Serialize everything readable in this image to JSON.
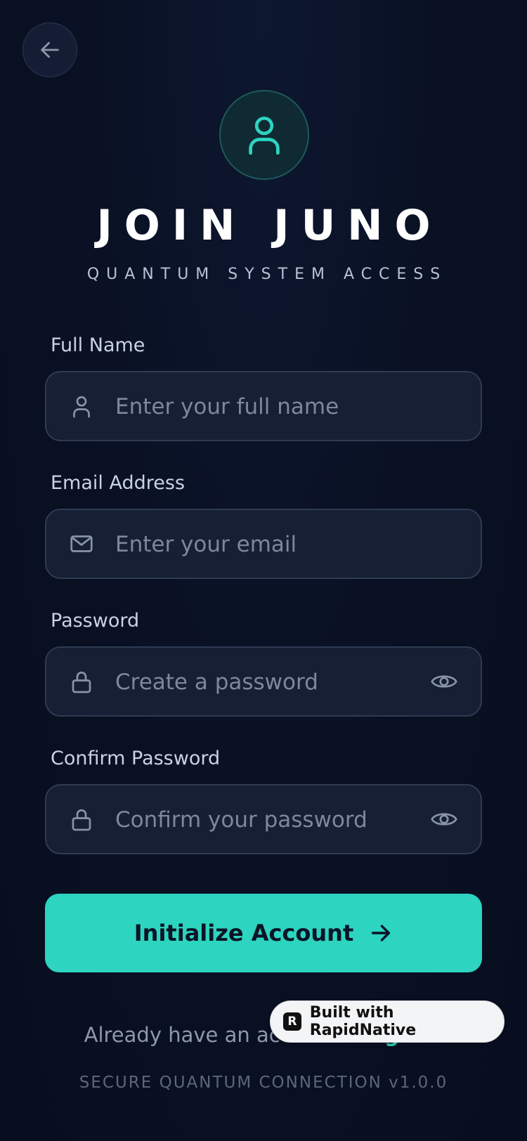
{
  "header": {
    "title": "JOIN JUNO",
    "subtitle": "QUANTUM SYSTEM ACCESS",
    "back_icon": "arrow-left-icon",
    "avatar_icon": "user-icon"
  },
  "form": {
    "full_name": {
      "label": "Full Name",
      "placeholder": "Enter your full name",
      "value": "",
      "icon": "user-icon"
    },
    "email": {
      "label": "Email Address",
      "placeholder": "Enter your email",
      "value": "",
      "icon": "mail-icon"
    },
    "password": {
      "label": "Password",
      "placeholder": "Create a password",
      "value": "",
      "icon": "lock-icon",
      "toggle_icon": "eye-icon"
    },
    "confirm_password": {
      "label": "Confirm Password",
      "placeholder": "Confirm your password",
      "value": "",
      "icon": "lock-icon",
      "toggle_icon": "eye-icon"
    },
    "submit_label": "Initialize Account"
  },
  "signin": {
    "prompt": "Already have an acc",
    "link": "ount? Sign In"
  },
  "footer": {
    "text": "SECURE QUANTUM CONNECTION v1.0.0"
  },
  "badge": {
    "logo": "R",
    "text": "Built with RapidNative"
  },
  "colors": {
    "accent": "#2dd4bf",
    "background": "#0a1124",
    "input_bg": "#161f33"
  }
}
